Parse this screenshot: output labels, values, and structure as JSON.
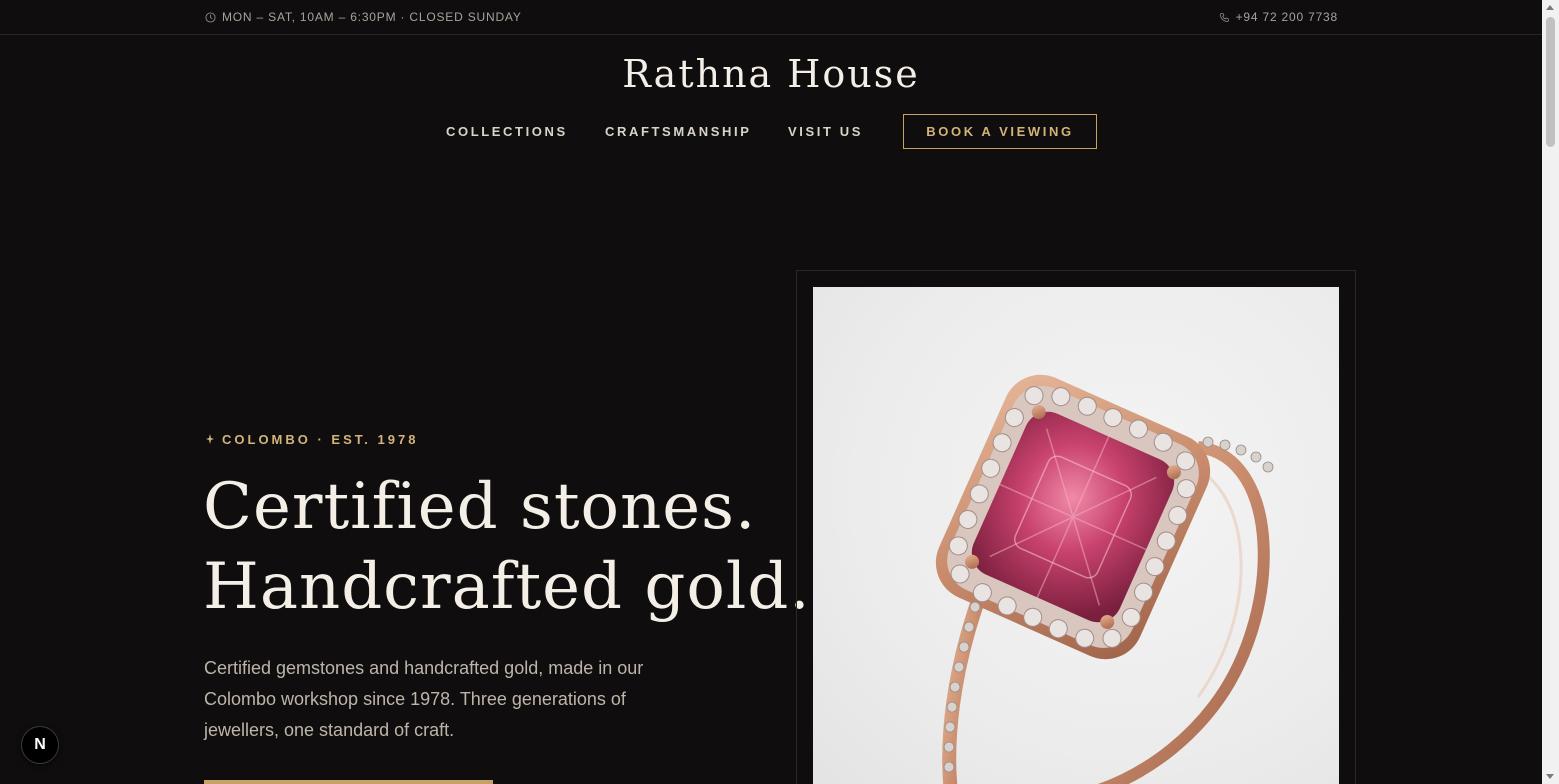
{
  "topbar": {
    "hours": "MON – SAT, 10AM – 6:30PM · CLOSED SUNDAY",
    "phone": "+94 72 200 7738",
    "hours_icon": "clock-icon",
    "phone_icon": "phone-icon"
  },
  "brand": {
    "name": "Rathna House"
  },
  "nav": {
    "items": [
      {
        "label": "COLLECTIONS"
      },
      {
        "label": "CRAFTSMANSHIP"
      },
      {
        "label": "VISIT US"
      }
    ],
    "cta_label": "BOOK A VIEWING"
  },
  "hero": {
    "eyebrow_icon": "sparkle-icon",
    "eyebrow": "COLOMBO · EST. 1978",
    "headline_line1": "Certified stones.",
    "headline_line2": "Handcrafted gold.",
    "intro": "Certified gemstones and handcrafted gold, made in our Colombo workshop since 1978. Three generations of jewellers, one standard of craft."
  },
  "badge": {
    "letter": "N"
  },
  "colors": {
    "background": "#0f0d0d",
    "accent_gold": "#c6a266",
    "text": "#f2ede4",
    "muted": "#a9a29a"
  }
}
